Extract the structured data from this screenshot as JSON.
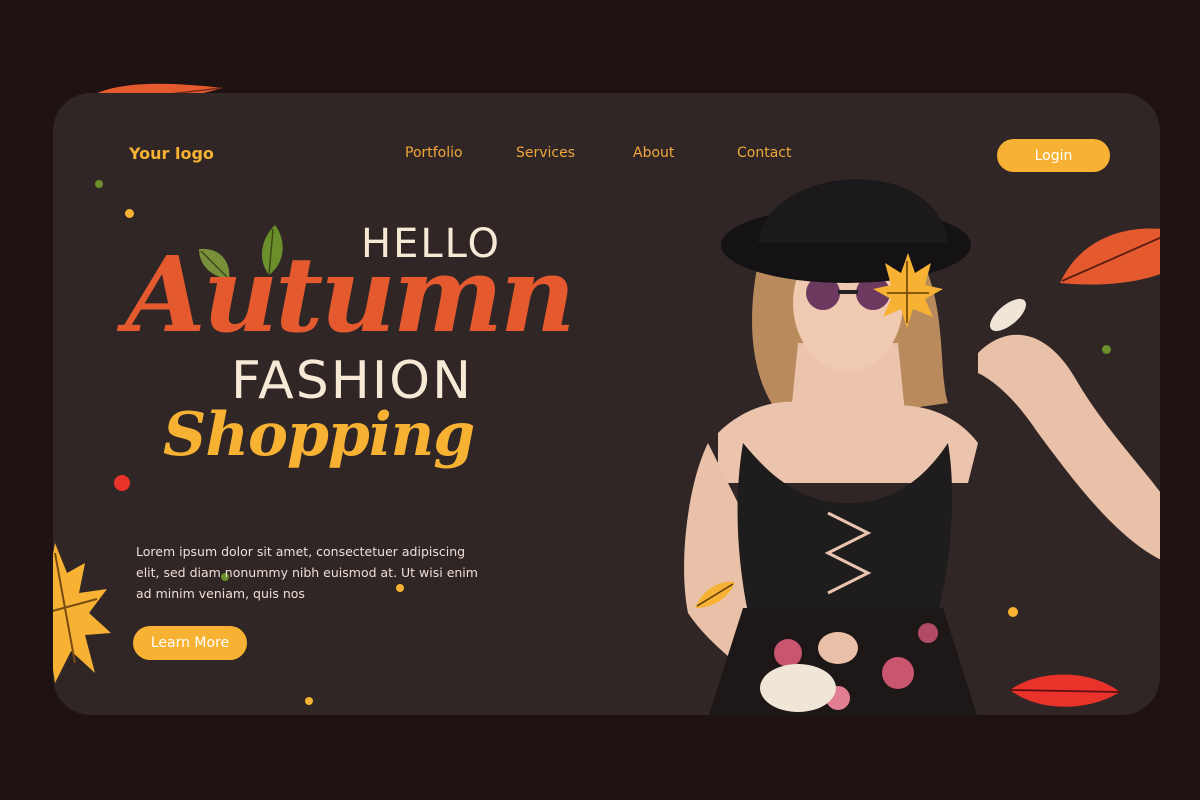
{
  "header": {
    "logo": "Your logo",
    "nav": [
      "Portfolio",
      "Services",
      "About",
      "Contact"
    ],
    "login_label": "Login"
  },
  "hero": {
    "line1": "HELLO",
    "line2": "Autumn",
    "line3": "FASHION",
    "line4": "Shopping",
    "description": "Lorem ipsum dolor sit amet, consectetuer adipiscing elit, sed diam nonummy nibh euismod at. Ut wisi enim ad minim veniam, quis nos",
    "cta_label": "Learn More"
  },
  "colors": {
    "page_bg": "#1e1213",
    "card_bg": "#312626",
    "accent_yellow": "#f7b233",
    "accent_orange": "#e45a2e",
    "cream": "#f6ead6"
  },
  "icons": [
    "maple-leaf-icon",
    "leaf-icon",
    "dot-decoration"
  ]
}
